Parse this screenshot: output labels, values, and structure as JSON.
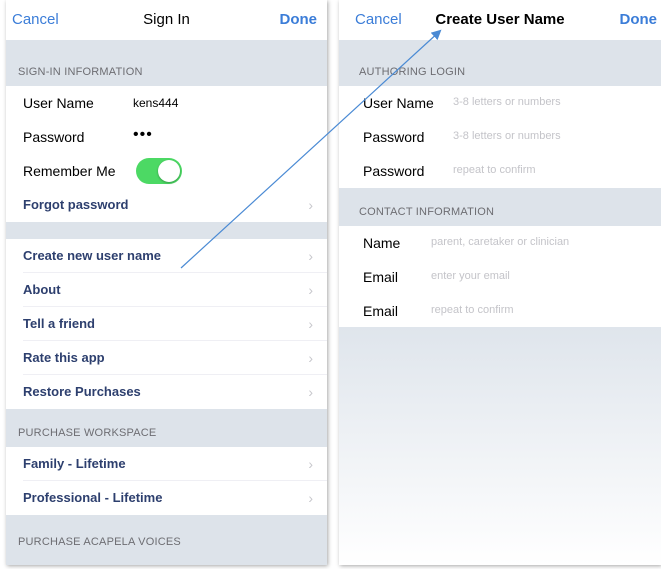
{
  "left_screen": {
    "nav": {
      "cancel": "Cancel",
      "title": "Sign In",
      "done": "Done"
    },
    "signin_section": {
      "header": "SIGN-IN INFORMATION",
      "user_name_label": "User Name",
      "user_name_value": "kens444",
      "password_label": "Password",
      "password_value": "•••",
      "remember_label": "Remember Me",
      "remember_on": true,
      "forgot_label": "Forgot password"
    },
    "actions": [
      {
        "label": "Create new user name"
      },
      {
        "label": "About"
      },
      {
        "label": "Tell a friend"
      },
      {
        "label": "Rate this app"
      },
      {
        "label": "Restore Purchases"
      }
    ],
    "workspace_section": {
      "header": "PURCHASE WORKSPACE",
      "items": [
        {
          "label": "Family - Lifetime"
        },
        {
          "label": "Professional - Lifetime"
        }
      ]
    },
    "voices_section": {
      "header": "PURCHASE ACAPELA VOICES"
    },
    "chevron": "›"
  },
  "right_screen": {
    "nav": {
      "cancel": "Cancel",
      "title": "Create User Name",
      "done": "Done"
    },
    "authoring_section": {
      "header": "AUTHORING LOGIN",
      "rows": [
        {
          "label": "User Name",
          "placeholder": "3-8 letters or numbers"
        },
        {
          "label": "Password",
          "placeholder": "3-8 letters or numbers"
        },
        {
          "label": "Password",
          "placeholder": "repeat to confirm"
        }
      ]
    },
    "contact_section": {
      "header": "CONTACT INFORMATION",
      "rows": [
        {
          "label": "Name",
          "placeholder": "parent, caretaker or clinician"
        },
        {
          "label": "Email",
          "placeholder": "enter your email"
        },
        {
          "label": "Email",
          "placeholder": "repeat to confirm"
        }
      ]
    }
  },
  "colors": {
    "accent": "#3b7dd8",
    "link_text": "#2d3f6e",
    "section_bg": "#dde3ea",
    "toggle_on": "#4cd964",
    "annotation_arrow": "#4a8ad4"
  },
  "icons": {
    "disclosure": "chevron-right-icon",
    "annotation": "arrow-annotation-icon"
  }
}
